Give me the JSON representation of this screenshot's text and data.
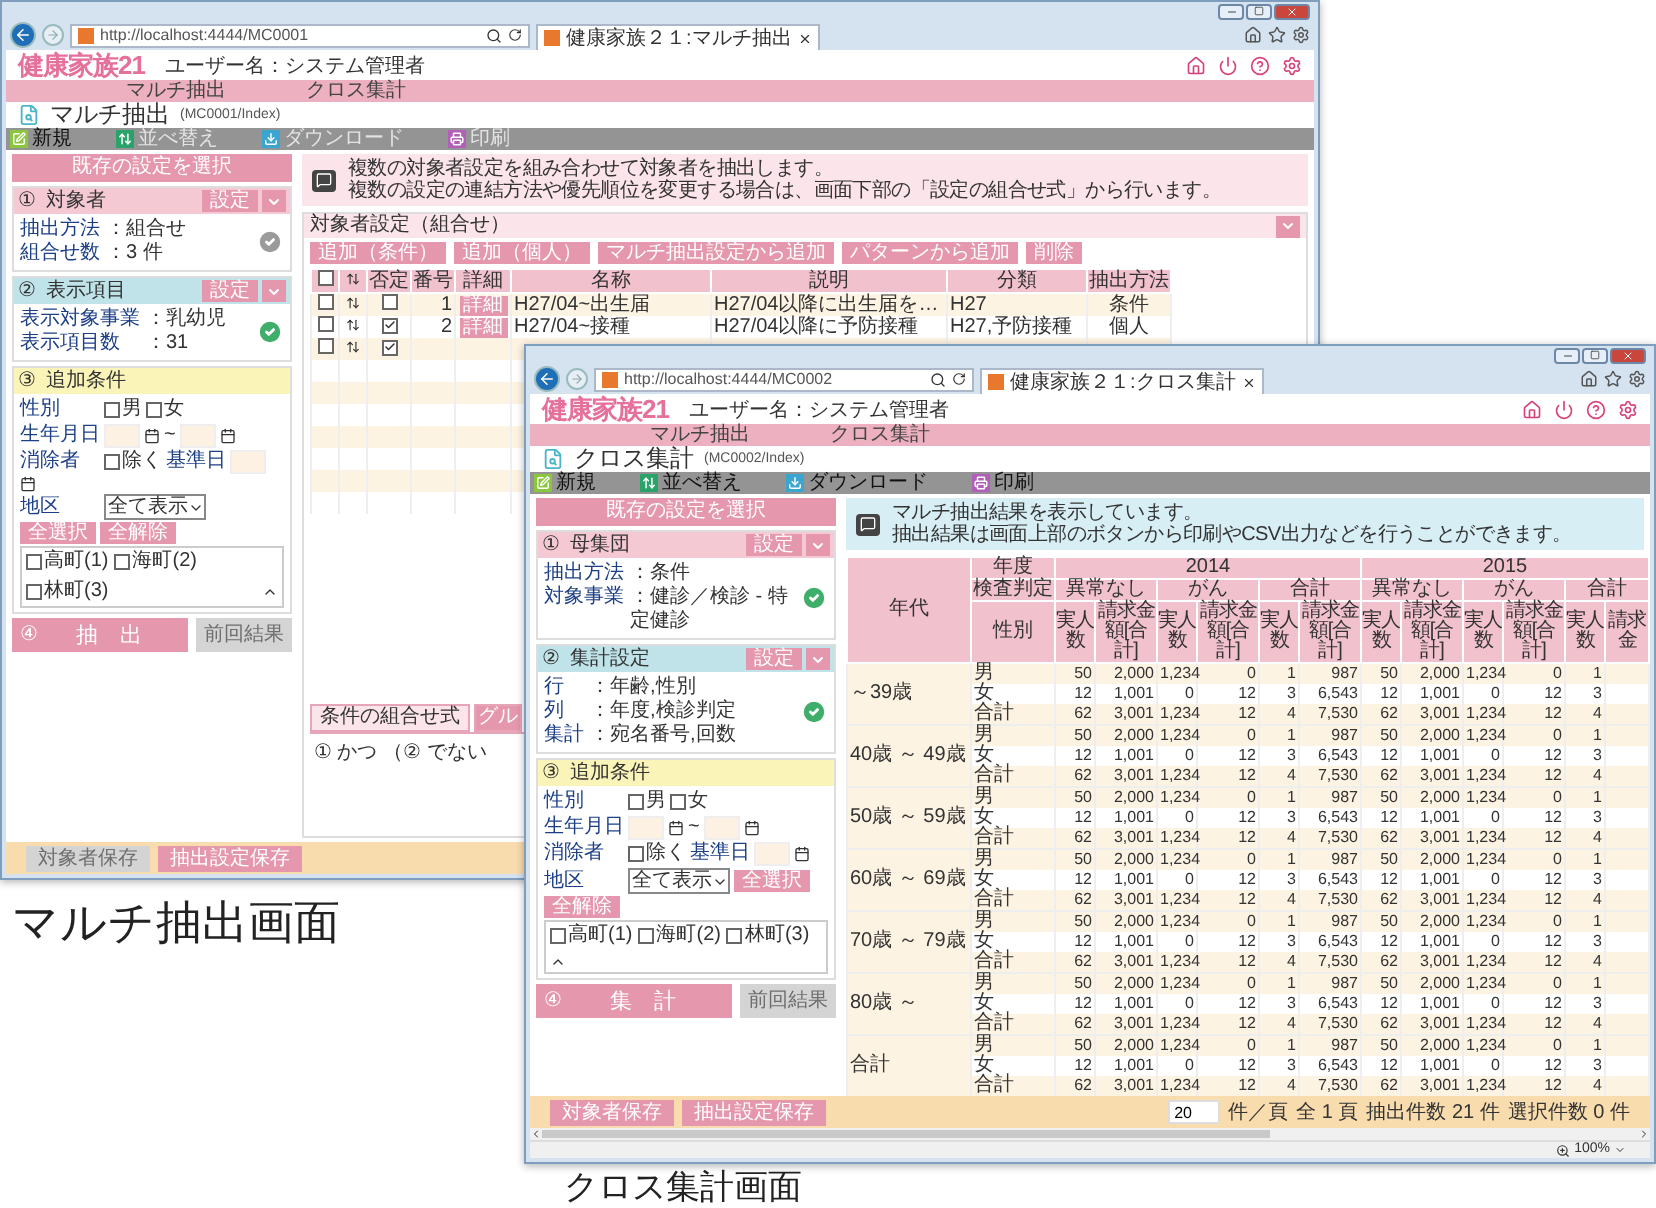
{
  "windows": [
    {
      "url": "http://localhost:4444/MC0001",
      "tab": "健康家族２１:マルチ抽出",
      "logo": "健康家族21",
      "user": "ユーザー名：システム管理者",
      "nav": [
        "マルチ抽出",
        "クロス集計"
      ],
      "page_title": "マルチ抽出",
      "page_path": "(MC0001/Index)",
      "toolbar": [
        {
          "kind": "new",
          "label": "新規",
          "disabled": false
        },
        {
          "kind": "sort",
          "label": "並べ替え",
          "disabled": true
        },
        {
          "kind": "download",
          "label": "ダウンロード",
          "disabled": true
        },
        {
          "kind": "print",
          "label": "印刷",
          "disabled": true
        }
      ],
      "preset_button": "既存の設定を選択",
      "sections": [
        {
          "kind": "summary",
          "number": "①",
          "title": "対象者",
          "color": "#f5c9d4",
          "button": "設定",
          "fields": [
            {
              "label": "抽出方法",
              "value": "：組合せ"
            },
            {
              "label": "組合せ数",
              "value": "：3 件"
            }
          ],
          "complete": false
        },
        {
          "kind": "summary",
          "number": "②",
          "title": "表示項目",
          "color": "#bfe3e8",
          "button": "設定",
          "fields": [
            {
              "label": "表示対象事業",
              "value": "：乳幼児"
            },
            {
              "label": "表示項目数",
              "value": "：31"
            }
          ],
          "complete": true
        },
        {
          "kind": "conditions",
          "number": "③",
          "title": "追加条件",
          "color": "#fbf4b9",
          "gender_label": "性別",
          "gender": [
            {
              "label": "男",
              "checked": false
            },
            {
              "label": "女",
              "checked": false
            }
          ],
          "birth_label": "生年月日",
          "birth_separator": "~",
          "exclude_label": "消除者",
          "exclude": {
            "label": "除く",
            "checked": false
          },
          "date_label": "基準日",
          "area_label": "地区",
          "area_select": "全て表示",
          "area_buttons": [
            "全選択",
            "全解除"
          ],
          "areas": [
            {
              "label": "高町(1)",
              "checked": false
            },
            {
              "label": "海町(2)",
              "checked": false
            },
            {
              "label": "林町(3)",
              "checked": false
            }
          ]
        }
      ],
      "run_button": {
        "number": "④",
        "label": "抽　出"
      },
      "previous_button": {
        "label": "前回結果",
        "disabled": true
      },
      "info": [
        "複数の対象者設定を組み合わせて対象者を抽出します。",
        "複数の設定の連結方法や優先順位を変更する場合は、画面下部の「設定の組合せ式」から行います。"
      ],
      "main": {
        "kind": "multi",
        "panel_title": "対象者設定（組合せ）",
        "all_selected": false,
        "actions": [
          "追加（条件）",
          "追加（個人）",
          "マルチ抽出設定から追加",
          "パターンから追加",
          "削除"
        ],
        "columns": [
          "否定",
          "番号",
          "詳細",
          "名称",
          "説明",
          "分類",
          "抽出方法"
        ],
        "rows": [
          {
            "selected": false,
            "negated": false,
            "number": "1",
            "detail": "詳細",
            "name": "H27/04~出生届",
            "description": "H27/04以降に出生届を…",
            "category": "H27",
            "method": "条件"
          },
          {
            "selected": false,
            "negated": true,
            "number": "2",
            "detail": "詳細",
            "name": "H27/04~接種",
            "description": "H27/04以降に予防接種",
            "category": "H27,予防接種",
            "method": "個人"
          },
          {
            "selected": false,
            "negated": true
          }
        ],
        "tabs": [
          {
            "label": "条件の組合せ式",
            "selected": true
          },
          {
            "label": "グル",
            "selected": false
          }
        ],
        "formula": "① かつ （② でない"
      },
      "footer_buttons": [
        {
          "label": "対象者保存",
          "disabled": true
        },
        {
          "label": "抽出設定保存",
          "disabled": false
        }
      ]
    },
    {
      "url": "http://localhost:4444/MC0002",
      "tab": "健康家族２１:クロス集計",
      "logo": "健康家族21",
      "user": "ユーザー名：システム管理者",
      "nav": [
        "マルチ抽出",
        "クロス集計"
      ],
      "page_title": "クロス集計",
      "page_path": "(MC0002/Index)",
      "toolbar": [
        {
          "kind": "new",
          "label": "新規",
          "disabled": false
        },
        {
          "kind": "sort",
          "label": "並べ替え",
          "disabled": false
        },
        {
          "kind": "download",
          "label": "ダウンロード",
          "disabled": false
        },
        {
          "kind": "print",
          "label": "印刷",
          "disabled": false
        }
      ],
      "preset_button": "既存の設定を選択",
      "sections": [
        {
          "kind": "summary",
          "number": "①",
          "title": "母集団",
          "color": "#f5c9d4",
          "button": "設定",
          "fields": [
            {
              "label": "抽出方法",
              "value": "：条件"
            },
            {
              "label": "対象事業",
              "value": "：健診／検診 - 特定健診"
            }
          ],
          "complete": true
        },
        {
          "kind": "summary",
          "number": "②",
          "title": "集計設定",
          "color": "#bfe3e8",
          "button": "設定",
          "fields": [
            {
              "label": "行",
              "value": "：年齢,性別"
            },
            {
              "label": "列",
              "value": "：年度,検診判定"
            },
            {
              "label": "集計",
              "value": "：宛名番号,回数"
            }
          ],
          "complete": true
        },
        {
          "kind": "conditions",
          "number": "③",
          "title": "追加条件",
          "color": "#fbf4b9",
          "gender_label": "性別",
          "gender": [
            {
              "label": "男",
              "checked": false
            },
            {
              "label": "女",
              "checked": false
            }
          ],
          "birth_label": "生年月日",
          "birth_separator": "~",
          "exclude_label": "消除者",
          "exclude": {
            "label": "除く",
            "checked": false
          },
          "date_label": "基準日",
          "area_label": "地区",
          "area_select": "全て表示",
          "area_buttons": [
            "全選択",
            "全解除"
          ],
          "areas": [
            {
              "label": "高町(1)",
              "checked": false
            },
            {
              "label": "海町(2)",
              "checked": false
            },
            {
              "label": "林町(3)",
              "checked": false
            }
          ]
        }
      ],
      "run_button": {
        "number": "④",
        "label": "集　計"
      },
      "previous_button": {
        "label": "前回結果",
        "disabled": true
      },
      "info": [
        "マルチ抽出結果を表示しています。",
        "抽出結果は画面上部のボタンから印刷やCSV出力などを行うことができます。"
      ],
      "main": {
        "kind": "cross",
        "corner": "年代",
        "header_labels": [
          "年度",
          "検査判定",
          "性別"
        ],
        "years": [
          {
            "label": "2014",
            "groups": [
              {
                "label": "異常なし",
                "measures": [
                  "実人数",
                  "請求金額[合計]"
                ]
              },
              {
                "label": "がん",
                "measures": [
                  "実人数",
                  "請求金額[合計]"
                ]
              },
              {
                "label": "合計",
                "measures": [
                  "実人数",
                  "請求金額[合計]"
                ]
              }
            ]
          },
          {
            "label": "2015",
            "groups": [
              {
                "label": "異常なし",
                "measures": [
                  "実人数",
                  "請求金額[合計]"
                ]
              },
              {
                "label": "がん",
                "measures": [
                  "実人数",
                  "請求金額[合計]"
                ]
              },
              {
                "label": "合計",
                "measures": [
                  "実人数",
                  "請求金"
                ]
              }
            ]
          }
        ],
        "row_groups": [
          {
            "label": "～39歳",
            "rows": [
              {
                "label": "男",
                "values": [
                  "50",
                  "2,000",
                  "1,234",
                  "0",
                  "1",
                  "987",
                  "50",
                  "2,000",
                  "1,234",
                  "0",
                  "1"
                ]
              },
              {
                "label": "女",
                "values": [
                  "12",
                  "1,001",
                  "0",
                  "12",
                  "3",
                  "6,543",
                  "12",
                  "1,001",
                  "0",
                  "12",
                  "3"
                ]
              },
              {
                "label": "合計",
                "values": [
                  "62",
                  "3,001",
                  "1,234",
                  "12",
                  "4",
                  "7,530",
                  "62",
                  "3,001",
                  "1,234",
                  "12",
                  "4"
                ]
              }
            ]
          },
          {
            "label": "40歳 ～ 49歳",
            "rows": [
              {
                "label": "男",
                "values": [
                  "50",
                  "2,000",
                  "1,234",
                  "0",
                  "1",
                  "987",
                  "50",
                  "2,000",
                  "1,234",
                  "0",
                  "1"
                ]
              },
              {
                "label": "女",
                "values": [
                  "12",
                  "1,001",
                  "0",
                  "12",
                  "3",
                  "6,543",
                  "12",
                  "1,001",
                  "0",
                  "12",
                  "3"
                ]
              },
              {
                "label": "合計",
                "values": [
                  "62",
                  "3,001",
                  "1,234",
                  "12",
                  "4",
                  "7,530",
                  "62",
                  "3,001",
                  "1,234",
                  "12",
                  "4"
                ]
              }
            ]
          },
          {
            "label": "50歳 ～ 59歳",
            "rows": [
              {
                "label": "男",
                "values": [
                  "50",
                  "2,000",
                  "1,234",
                  "0",
                  "1",
                  "987",
                  "50",
                  "2,000",
                  "1,234",
                  "0",
                  "1"
                ]
              },
              {
                "label": "女",
                "values": [
                  "12",
                  "1,001",
                  "0",
                  "12",
                  "3",
                  "6,543",
                  "12",
                  "1,001",
                  "0",
                  "12",
                  "3"
                ]
              },
              {
                "label": "合計",
                "values": [
                  "62",
                  "3,001",
                  "1,234",
                  "12",
                  "4",
                  "7,530",
                  "62",
                  "3,001",
                  "1,234",
                  "12",
                  "4"
                ]
              }
            ]
          },
          {
            "label": "60歳 ～ 69歳",
            "rows": [
              {
                "label": "男",
                "values": [
                  "50",
                  "2,000",
                  "1,234",
                  "0",
                  "1",
                  "987",
                  "50",
                  "2,000",
                  "1,234",
                  "0",
                  "1"
                ]
              },
              {
                "label": "女",
                "values": [
                  "12",
                  "1,001",
                  "0",
                  "12",
                  "3",
                  "6,543",
                  "12",
                  "1,001",
                  "0",
                  "12",
                  "3"
                ]
              },
              {
                "label": "合計",
                "values": [
                  "62",
                  "3,001",
                  "1,234",
                  "12",
                  "4",
                  "7,530",
                  "62",
                  "3,001",
                  "1,234",
                  "12",
                  "4"
                ]
              }
            ]
          },
          {
            "label": "70歳 ～ 79歳",
            "rows": [
              {
                "label": "男",
                "values": [
                  "50",
                  "2,000",
                  "1,234",
                  "0",
                  "1",
                  "987",
                  "50",
                  "2,000",
                  "1,234",
                  "0",
                  "1"
                ]
              },
              {
                "label": "女",
                "values": [
                  "12",
                  "1,001",
                  "0",
                  "12",
                  "3",
                  "6,543",
                  "12",
                  "1,001",
                  "0",
                  "12",
                  "3"
                ]
              },
              {
                "label": "合計",
                "values": [
                  "62",
                  "3,001",
                  "1,234",
                  "12",
                  "4",
                  "7,530",
                  "62",
                  "3,001",
                  "1,234",
                  "12",
                  "4"
                ]
              }
            ]
          },
          {
            "label": "80歳 ～",
            "rows": [
              {
                "label": "男",
                "values": [
                  "50",
                  "2,000",
                  "1,234",
                  "0",
                  "1",
                  "987",
                  "50",
                  "2,000",
                  "1,234",
                  "0",
                  "1"
                ]
              },
              {
                "label": "女",
                "values": [
                  "12",
                  "1,001",
                  "0",
                  "12",
                  "3",
                  "6,543",
                  "12",
                  "1,001",
                  "0",
                  "12",
                  "3"
                ]
              },
              {
                "label": "合計",
                "values": [
                  "62",
                  "3,001",
                  "1,234",
                  "12",
                  "4",
                  "7,530",
                  "62",
                  "3,001",
                  "1,234",
                  "12",
                  "4"
                ]
              }
            ]
          },
          {
            "label": "合計",
            "rows": [
              {
                "label": "男",
                "values": [
                  "50",
                  "2,000",
                  "1,234",
                  "0",
                  "1",
                  "987",
                  "50",
                  "2,000",
                  "1,234",
                  "0",
                  "1"
                ]
              },
              {
                "label": "女",
                "values": [
                  "12",
                  "1,001",
                  "0",
                  "12",
                  "3",
                  "6,543",
                  "12",
                  "1,001",
                  "0",
                  "12",
                  "3"
                ]
              },
              {
                "label": "合計",
                "values": [
                  "62",
                  "3,001",
                  "1,234",
                  "12",
                  "4",
                  "7,530",
                  "62",
                  "3,001",
                  "1,234",
                  "12",
                  "4"
                ]
              }
            ]
          }
        ]
      },
      "footer_buttons": [
        {
          "label": "対象者保存",
          "disabled": false
        },
        {
          "label": "抽出設定保存",
          "disabled": false
        }
      ],
      "pager": {
        "page_size": "20",
        "per_page": "件／頁",
        "pages": "全 1 頁",
        "extracted": "抽出件数 21 件",
        "selected": "選択件数 0 件"
      },
      "zoom": "100%"
    }
  ],
  "captions": [
    "マルチ抽出画面",
    "クロス集計画面"
  ]
}
